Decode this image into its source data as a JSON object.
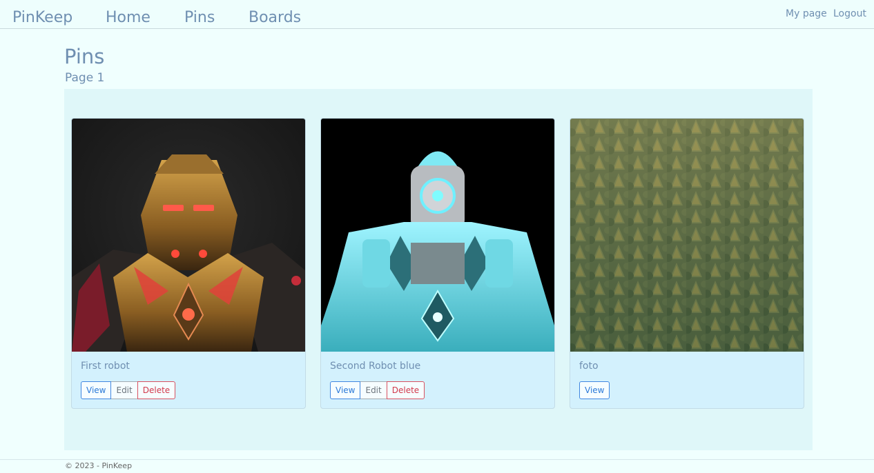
{
  "nav": {
    "brand": "PinKeep",
    "links": [
      "Home",
      "Pins",
      "Boards"
    ],
    "my_page": "My page",
    "logout": "Logout"
  },
  "page": {
    "title": "Pins",
    "subtitle": "Page 1"
  },
  "pins": [
    {
      "title": "First robot",
      "image": "golden-robot-image",
      "buttons": {
        "view": "View",
        "edit": "Edit",
        "delete": "Delete"
      }
    },
    {
      "title": "Second Robot blue",
      "image": "cyan-robot-image",
      "buttons": {
        "view": "View",
        "edit": "Edit",
        "delete": "Delete"
      }
    },
    {
      "title": "foto",
      "image": "forest-image",
      "buttons": {
        "view": "View"
      }
    }
  ],
  "footer": {
    "text": "© 2023 - PinKeep"
  },
  "colors": {
    "background": "#f0fffe",
    "nav_text": "#6f8fb1",
    "board_bg": "#dff7f9",
    "card_bg": "#d3f1fd",
    "view_button": "#2b79d8",
    "edit_button": "#6c757d",
    "delete_button": "#d2394b"
  }
}
